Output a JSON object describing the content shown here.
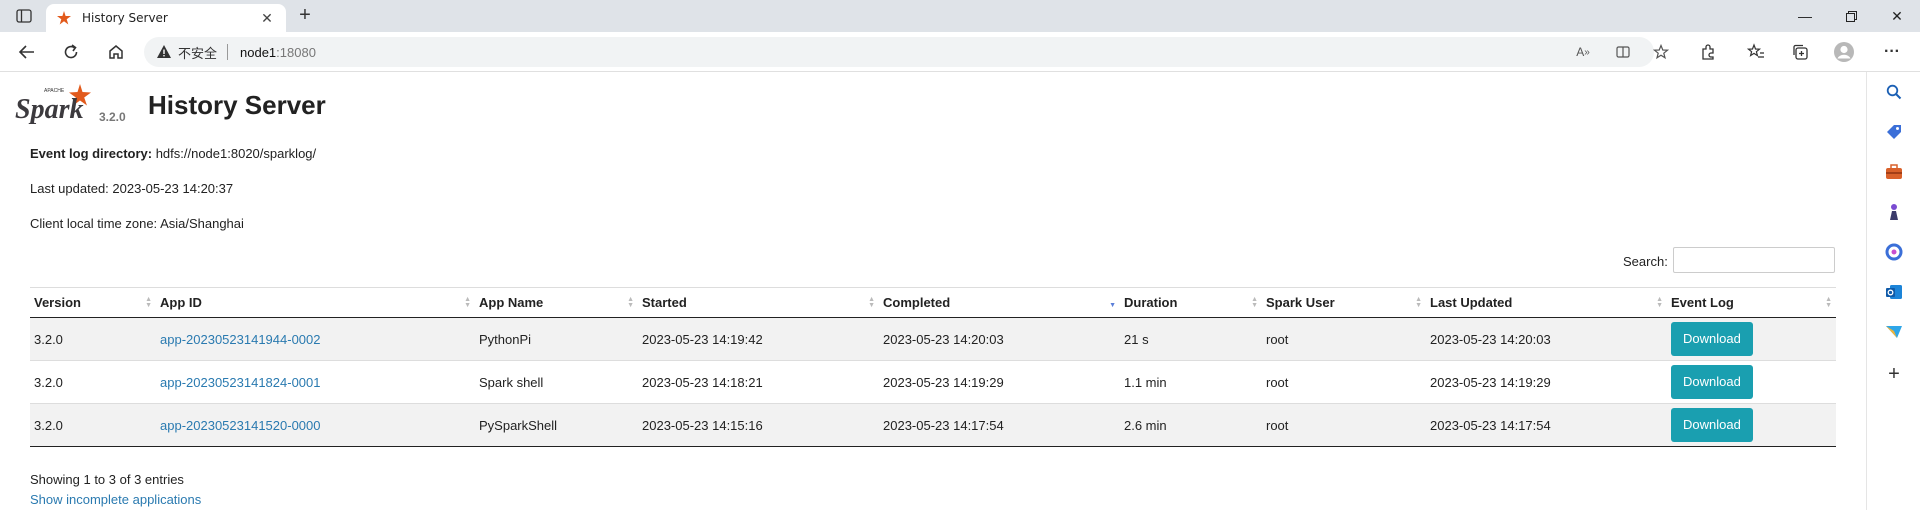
{
  "browser": {
    "tab_title": "History Server",
    "insecure_label": "不安全",
    "url_host": "node1",
    "url_port": ":18080"
  },
  "page": {
    "version": "3.2.0",
    "title": "History Server",
    "event_log_label": "Event log directory:",
    "event_log_value": " hdfs://node1:8020/sparklog/",
    "last_updated": "Last updated: 2023-05-23 14:20:37",
    "timezone": "Client local time zone: Asia/Shanghai",
    "search_label": "Search:",
    "search_value": "",
    "columns": [
      "Version",
      "App ID",
      "App Name",
      "Started",
      "Completed",
      "Duration",
      "Spark User",
      "Last Updated",
      "Event Log"
    ],
    "sorted_column": "Completed",
    "rows": [
      {
        "version": "3.2.0",
        "app_id": "app-20230523141944-0002",
        "app_name": "PythonPi",
        "started": "2023-05-23 14:19:42",
        "completed": "2023-05-23 14:20:03",
        "duration": "21 s",
        "user": "root",
        "last_updated": "2023-05-23 14:20:03",
        "event_log": "Download"
      },
      {
        "version": "3.2.0",
        "app_id": "app-20230523141824-0001",
        "app_name": "Spark shell",
        "started": "2023-05-23 14:18:21",
        "completed": "2023-05-23 14:19:29",
        "duration": "1.1 min",
        "user": "root",
        "last_updated": "2023-05-23 14:19:29",
        "event_log": "Download"
      },
      {
        "version": "3.2.0",
        "app_id": "app-20230523141520-0000",
        "app_name": "PySparkShell",
        "started": "2023-05-23 14:15:16",
        "completed": "2023-05-23 14:17:54",
        "duration": "2.6 min",
        "user": "root",
        "last_updated": "2023-05-23 14:17:54",
        "event_log": "Download"
      }
    ],
    "showing": "Showing 1 to 3 of 3 entries",
    "incomplete_link": "Show incomplete applications"
  },
  "colors": {
    "link": "#2a7ab0",
    "download_button": "#1a9fb0",
    "spark_orange": "#e25a1c"
  }
}
